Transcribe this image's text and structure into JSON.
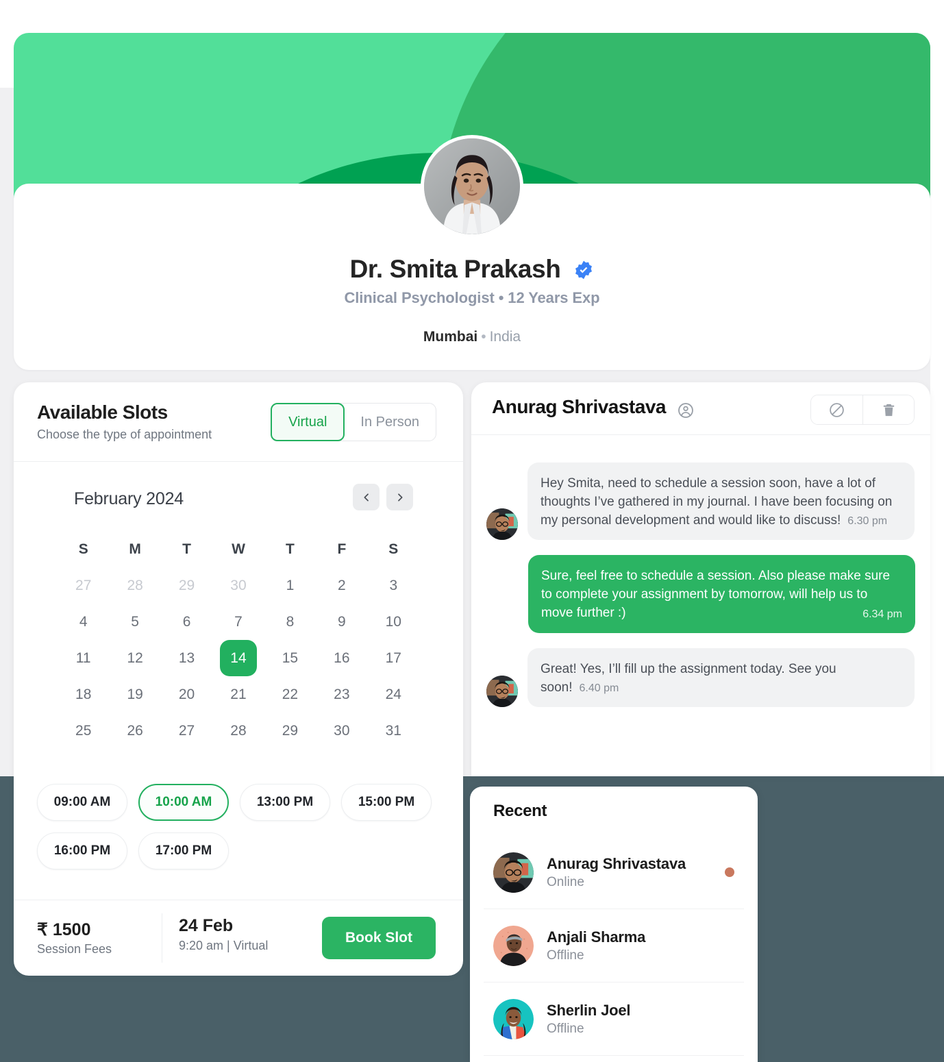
{
  "theme": {
    "accent_green": "#22b05f",
    "banner_light_green": "#52df99",
    "banner_mid_green": "#34b96b",
    "banner_dark_green": "#00a152",
    "page_dark_bg": "#4a6068",
    "page_light_bg": "#f0f0f2",
    "verified_blue": "#3b82f6",
    "online_dot": "#c9785e"
  },
  "profile": {
    "name": "Dr. Smita Prakash",
    "verified_icon": "verified-badge-icon",
    "subtitle": "Clinical Psychologist • 12 Years Exp",
    "city": "Mumbai",
    "separator": "•",
    "country": "India",
    "avatar_icon": "doctor-avatar"
  },
  "slots": {
    "title": "Available Slots",
    "subtitle": "Choose the type of appointment",
    "toggle": {
      "options": [
        "Virtual",
        "In Person"
      ],
      "selected": "Virtual"
    },
    "calendar": {
      "month_label": "February 2024",
      "prev_icon": "chevron-left-icon",
      "next_icon": "chevron-right-icon",
      "day_headers": [
        "S",
        "M",
        "T",
        "W",
        "T",
        "F",
        "S"
      ],
      "selected_day": 14,
      "weeks": [
        [
          {
            "d": "27",
            "muted": true
          },
          {
            "d": "28",
            "muted": true
          },
          {
            "d": "29",
            "muted": true
          },
          {
            "d": "30",
            "muted": true
          },
          {
            "d": "1",
            "muted": false
          },
          {
            "d": "2",
            "muted": false
          },
          {
            "d": "3",
            "muted": false
          }
        ],
        [
          {
            "d": "4",
            "muted": false
          },
          {
            "d": "5",
            "muted": false
          },
          {
            "d": "6",
            "muted": false
          },
          {
            "d": "7",
            "muted": false
          },
          {
            "d": "8",
            "muted": false
          },
          {
            "d": "9",
            "muted": false
          },
          {
            "d": "10",
            "muted": false
          }
        ],
        [
          {
            "d": "11",
            "muted": false
          },
          {
            "d": "12",
            "muted": false
          },
          {
            "d": "13",
            "muted": false
          },
          {
            "d": "14",
            "muted": false,
            "selected": true
          },
          {
            "d": "15",
            "muted": false
          },
          {
            "d": "16",
            "muted": false
          },
          {
            "d": "17",
            "muted": false
          }
        ],
        [
          {
            "d": "18",
            "muted": false
          },
          {
            "d": "19",
            "muted": false
          },
          {
            "d": "20",
            "muted": false
          },
          {
            "d": "21",
            "muted": false
          },
          {
            "d": "22",
            "muted": false
          },
          {
            "d": "23",
            "muted": false
          },
          {
            "d": "24",
            "muted": false
          }
        ],
        [
          {
            "d": "25",
            "muted": false
          },
          {
            "d": "26",
            "muted": false
          },
          {
            "d": "27",
            "muted": false
          },
          {
            "d": "28",
            "muted": false
          },
          {
            "d": "29",
            "muted": false
          },
          {
            "d": "30",
            "muted": false
          },
          {
            "d": "31",
            "muted": false
          }
        ]
      ]
    },
    "times": [
      {
        "label": "09:00 AM",
        "selected": false
      },
      {
        "label": "10:00 AM",
        "selected": true
      },
      {
        "label": "13:00 PM",
        "selected": false
      },
      {
        "label": "15:00 PM",
        "selected": false
      },
      {
        "label": "16:00 PM",
        "selected": false
      },
      {
        "label": "17:00 PM",
        "selected": false
      }
    ],
    "footer": {
      "fee_amount": "₹ 1500",
      "fee_label": "Session Fees",
      "date": "24 Feb",
      "detail": "9:20 am | Virtual",
      "book_button": "Book Slot"
    }
  },
  "chat": {
    "title": "Anurag Shrivastava",
    "user_icon": "user-circle-icon",
    "block_icon": "block-icon",
    "delete_icon": "trash-icon",
    "messages": [
      {
        "direction": "incoming",
        "text": "Hey Smita, need to schedule a session soon, have a lot of thoughts I’ve gathered in my journal. I have been focusing on my personal development and would like to discuss!",
        "time": "6.30 pm",
        "avatar_icon": "anurag-avatar"
      },
      {
        "direction": "outgoing",
        "text": "Sure, feel free to schedule a session. Also please make sure to complete your assignment by tomorrow, will help us to move further :)",
        "time": "6.34 pm"
      },
      {
        "direction": "incoming",
        "text": "Great! Yes, I’ll fill up the assignment today. See you soon!",
        "time": "6.40 pm",
        "avatar_icon": "anurag-avatar"
      }
    ]
  },
  "recent": {
    "title": "Recent",
    "items": [
      {
        "name": "Anurag Shrivastava",
        "status": "Online",
        "has_dot": true,
        "avatar_icon": "anurag-avatar"
      },
      {
        "name": "Anjali Sharma",
        "status": "Offline",
        "has_dot": false,
        "avatar_icon": "anjali-avatar"
      },
      {
        "name": "Sherlin Joel",
        "status": "Offline",
        "has_dot": false,
        "avatar_icon": "sherlin-avatar"
      }
    ]
  }
}
